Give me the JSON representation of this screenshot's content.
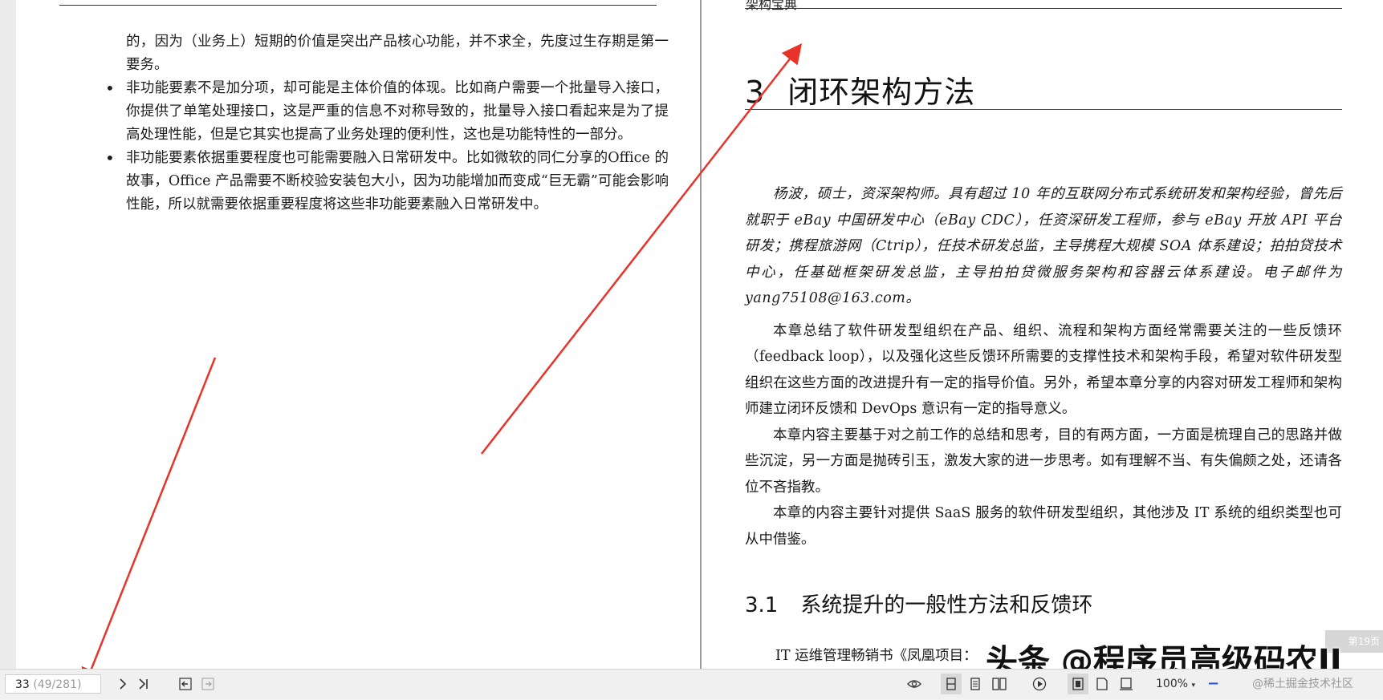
{
  "left_page": {
    "continuation": "的，因为（业务上）短期的价值是突出产品核心功能，并不求全，先度过生存期是第一要务。",
    "bullets": [
      "非功能要素不是加分项，却可能是主体价值的体现。比如商户需要一个批量导入接口，你提供了单笔处理接口，这是严重的信息不对称导致的，批量导入接口看起来是为了提高处理性能，但是它其实也提高了业务处理的便利性，这也是功能特性的一部分。",
      "非功能要素依据重要程度也可能需要融入日常研发中。比如微软的同仁分享的Office 的故事，Office 产品需要不断校验安装包大小，因为功能增加而变成“巨无霸”可能会影响性能，所以就需要依据重要程度将这些非功能要素融入日常研发中。"
    ]
  },
  "right_page": {
    "running_head": "架构宝典",
    "chapter_number": "3",
    "chapter_title": "闭环架构方法",
    "author_bio": "杨波，硕士，资深架构师。具有超过 10 年的互联网分布式系统研发和架构经验，曾先后就职于 eBay 中国研发中心（eBay CDC），任资深研发工程师，参与 eBay 开放 API 平台研发；携程旅游网（Ctrip），任技术研发总监，主导携程大规模 SOA 体系建设；拍拍贷技术中心，任基础框架研发总监，主导拍拍贷微服务架构和容器云体系建设。电子邮件为 yang75108@163.com。",
    "paragraphs": [
      "本章总结了软件研发型组织在产品、组织、流程和架构方面经常需要关注的一些反馈环（feedback loop），以及强化这些反馈环所需要的支撑性技术和架构手段，希望对软件研发型组织在这些方面的改进提升有一定的指导价值。另外，希望本章分享的内容对研发工程师和架构师建立闭环反馈和 DevOps 意识有一定的指导意义。",
      "本章内容主要基于对之前工作的总结和思考，目的有两方面，一方面是梳理自己的思路并做些沉淀，另一方面是抛砖引玉，激发大家的进一步思考。如有理解不当、有失偏颇之处，还请各位不吝指教。",
      "本章的内容主要针对提供 SaaS 服务的软件研发型组织，其他涉及 IT 系统的组织类型也可从中借鉴。"
    ],
    "section_number": "3.1",
    "section_title": "系统提升的一般性方法和反馈环",
    "section_body": "IT 运维管理畅销书《凤凰项目：",
    "page_tab": "第19页"
  },
  "watermark": "头条 @程序员高级码农II",
  "toolbar": {
    "page_current": "33",
    "page_total": "(49/281)",
    "zoom": "100%",
    "zoom_minus": "−",
    "community": "@稀土掘金技术社区"
  },
  "colors": {
    "arrow": "#e8332a",
    "zoom_minus": "#2255cc"
  }
}
